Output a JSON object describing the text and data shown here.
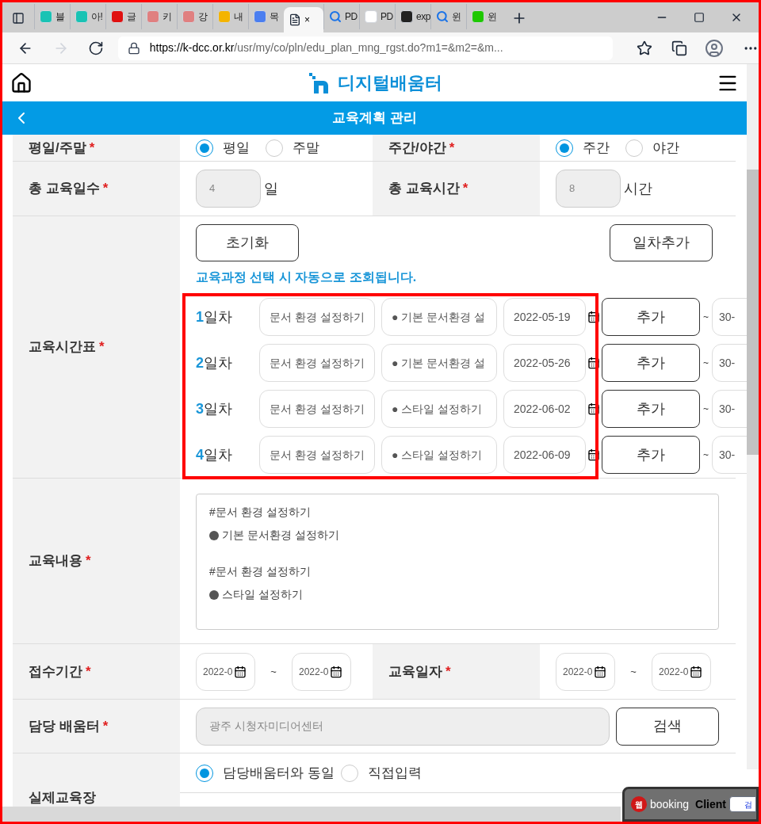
{
  "browser": {
    "tabs": [
      {
        "label": "블",
        "kind": "happy",
        "selected": false
      },
      {
        "label": "아!",
        "kind": "happy",
        "selected": false
      },
      {
        "label": "글",
        "kind": "red",
        "selected": false
      },
      {
        "label": "키",
        "kind": "pink",
        "selected": false
      },
      {
        "label": "강",
        "kind": "pink",
        "selected": false
      },
      {
        "label": "내",
        "kind": "drive",
        "selected": false
      },
      {
        "label": "목",
        "kind": "doc",
        "selected": false
      },
      {
        "label": "×",
        "kind": "page",
        "selected": true
      },
      {
        "label": "PD",
        "kind": "search",
        "selected": false
      },
      {
        "label": "PD",
        "kind": "wiki",
        "selected": false
      },
      {
        "label": "exp",
        "kind": "github",
        "selected": false
      },
      {
        "label": "윈",
        "kind": "search",
        "selected": false
      },
      {
        "label": "윈",
        "kind": "blog",
        "selected": false
      }
    ],
    "url_host": "https://k-dcc.or.kr",
    "url_path": "/usr/my/co/pln/edu_plan_mng_rgst.do?m1=&m2=&m..."
  },
  "site": {
    "logo": "디지털배움터"
  },
  "page_header": {
    "title": "교육계획 관리"
  },
  "form": {
    "weekday": {
      "label": "평일/주말",
      "required_mark": "*",
      "options": [
        {
          "label": "평일",
          "selected": true
        },
        {
          "label": "주말",
          "selected": false
        }
      ]
    },
    "daynight": {
      "label": "주간/야간",
      "required_mark": "*",
      "options": [
        {
          "label": "주간",
          "selected": true
        },
        {
          "label": "야간",
          "selected": false
        }
      ]
    },
    "total_days": {
      "label": "총 교육일수",
      "required_mark": "*",
      "value": "4",
      "unit": "일"
    },
    "total_hours": {
      "label": "총 교육시간",
      "required_mark": "*",
      "value": "8",
      "unit": "시간"
    },
    "timetable": {
      "label": "교육시간표",
      "required_mark": "*",
      "reset_button": "초기화",
      "add_day_button": "일차추가",
      "hint": "교육과정 선택 시 자동으로 조회됩니다.",
      "days": [
        {
          "number": "1",
          "suffix": "일차",
          "course": "문서 환경 설정하기",
          "topic": "● 기본 문서환경 설",
          "date": "2022-05-19",
          "add_button": "추가",
          "separator": "~",
          "time": "30-"
        },
        {
          "number": "2",
          "suffix": "일차",
          "course": "문서 환경 설정하기",
          "topic": "● 기본 문서환경 설",
          "date": "2022-05-26",
          "add_button": "추가",
          "separator": "~",
          "time": "30-"
        },
        {
          "number": "3",
          "suffix": "일차",
          "course": "문서 환경 설정하기",
          "topic": "● 스타일 설정하기",
          "date": "2022-06-02",
          "add_button": "추가",
          "separator": "~",
          "time": "30-"
        },
        {
          "number": "4",
          "suffix": "일차",
          "course": "문서 환경 설정하기",
          "topic": "● 스타일 설정하기",
          "date": "2022-06-09",
          "add_button": "추가",
          "separator": "~",
          "time": "30-"
        }
      ]
    },
    "content": {
      "label": "교육내용",
      "required_mark": "*",
      "blocks": [
        {
          "heading": "#문서 환경 설정하기",
          "item": "기본 문서환경 설정하기"
        },
        {
          "heading": "#문서 환경 설정하기",
          "item": "스타일 설정하기"
        }
      ]
    },
    "reception": {
      "label": "접수기간",
      "required_mark": "*",
      "from": "2022-0",
      "separator": "~",
      "to": "2022-0"
    },
    "edu_date": {
      "label": "교육일자",
      "required_mark": "*",
      "from": "2022-0",
      "separator": "~",
      "to": "2022-0"
    },
    "center": {
      "label": "담당 배움터",
      "required_mark": "*",
      "value": "광주 시청자미디어센터",
      "button": "검색"
    },
    "venue": {
      "label": "실제교육장",
      "options": [
        {
          "label": "담당배움터와 동일",
          "selected": true
        },
        {
          "label": "직접입력",
          "selected": false
        }
      ]
    }
  },
  "widget": {
    "logo": "웹",
    "brand": "booking",
    "title": "Client",
    "field_text": "검"
  }
}
